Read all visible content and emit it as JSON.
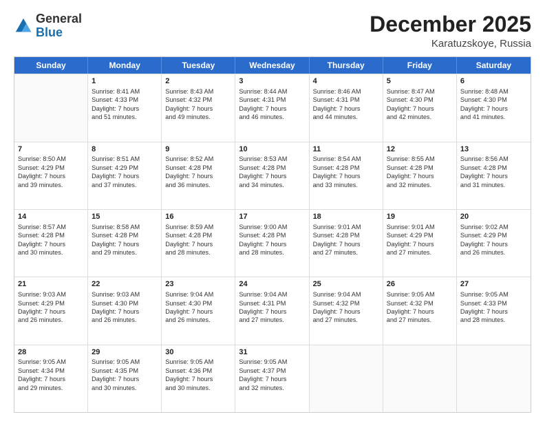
{
  "logo": {
    "general": "General",
    "blue": "Blue"
  },
  "title": "December 2025",
  "location": "Karatuzskoye, Russia",
  "days_of_week": [
    "Sunday",
    "Monday",
    "Tuesday",
    "Wednesday",
    "Thursday",
    "Friday",
    "Saturday"
  ],
  "weeks": [
    [
      {
        "day": "",
        "info": [],
        "empty": true
      },
      {
        "day": "1",
        "info": [
          "Sunrise: 8:41 AM",
          "Sunset: 4:33 PM",
          "Daylight: 7 hours",
          "and 51 minutes."
        ]
      },
      {
        "day": "2",
        "info": [
          "Sunrise: 8:43 AM",
          "Sunset: 4:32 PM",
          "Daylight: 7 hours",
          "and 49 minutes."
        ]
      },
      {
        "day": "3",
        "info": [
          "Sunrise: 8:44 AM",
          "Sunset: 4:31 PM",
          "Daylight: 7 hours",
          "and 46 minutes."
        ]
      },
      {
        "day": "4",
        "info": [
          "Sunrise: 8:46 AM",
          "Sunset: 4:31 PM",
          "Daylight: 7 hours",
          "and 44 minutes."
        ]
      },
      {
        "day": "5",
        "info": [
          "Sunrise: 8:47 AM",
          "Sunset: 4:30 PM",
          "Daylight: 7 hours",
          "and 42 minutes."
        ]
      },
      {
        "day": "6",
        "info": [
          "Sunrise: 8:48 AM",
          "Sunset: 4:30 PM",
          "Daylight: 7 hours",
          "and 41 minutes."
        ]
      }
    ],
    [
      {
        "day": "7",
        "info": [
          "Sunrise: 8:50 AM",
          "Sunset: 4:29 PM",
          "Daylight: 7 hours",
          "and 39 minutes."
        ]
      },
      {
        "day": "8",
        "info": [
          "Sunrise: 8:51 AM",
          "Sunset: 4:29 PM",
          "Daylight: 7 hours",
          "and 37 minutes."
        ]
      },
      {
        "day": "9",
        "info": [
          "Sunrise: 8:52 AM",
          "Sunset: 4:28 PM",
          "Daylight: 7 hours",
          "and 36 minutes."
        ]
      },
      {
        "day": "10",
        "info": [
          "Sunrise: 8:53 AM",
          "Sunset: 4:28 PM",
          "Daylight: 7 hours",
          "and 34 minutes."
        ]
      },
      {
        "day": "11",
        "info": [
          "Sunrise: 8:54 AM",
          "Sunset: 4:28 PM",
          "Daylight: 7 hours",
          "and 33 minutes."
        ]
      },
      {
        "day": "12",
        "info": [
          "Sunrise: 8:55 AM",
          "Sunset: 4:28 PM",
          "Daylight: 7 hours",
          "and 32 minutes."
        ]
      },
      {
        "day": "13",
        "info": [
          "Sunrise: 8:56 AM",
          "Sunset: 4:28 PM",
          "Daylight: 7 hours",
          "and 31 minutes."
        ]
      }
    ],
    [
      {
        "day": "14",
        "info": [
          "Sunrise: 8:57 AM",
          "Sunset: 4:28 PM",
          "Daylight: 7 hours",
          "and 30 minutes."
        ]
      },
      {
        "day": "15",
        "info": [
          "Sunrise: 8:58 AM",
          "Sunset: 4:28 PM",
          "Daylight: 7 hours",
          "and 29 minutes."
        ]
      },
      {
        "day": "16",
        "info": [
          "Sunrise: 8:59 AM",
          "Sunset: 4:28 PM",
          "Daylight: 7 hours",
          "and 28 minutes."
        ]
      },
      {
        "day": "17",
        "info": [
          "Sunrise: 9:00 AM",
          "Sunset: 4:28 PM",
          "Daylight: 7 hours",
          "and 28 minutes."
        ]
      },
      {
        "day": "18",
        "info": [
          "Sunrise: 9:01 AM",
          "Sunset: 4:28 PM",
          "Daylight: 7 hours",
          "and 27 minutes."
        ]
      },
      {
        "day": "19",
        "info": [
          "Sunrise: 9:01 AM",
          "Sunset: 4:29 PM",
          "Daylight: 7 hours",
          "and 27 minutes."
        ]
      },
      {
        "day": "20",
        "info": [
          "Sunrise: 9:02 AM",
          "Sunset: 4:29 PM",
          "Daylight: 7 hours",
          "and 26 minutes."
        ]
      }
    ],
    [
      {
        "day": "21",
        "info": [
          "Sunrise: 9:03 AM",
          "Sunset: 4:29 PM",
          "Daylight: 7 hours",
          "and 26 minutes."
        ]
      },
      {
        "day": "22",
        "info": [
          "Sunrise: 9:03 AM",
          "Sunset: 4:30 PM",
          "Daylight: 7 hours",
          "and 26 minutes."
        ]
      },
      {
        "day": "23",
        "info": [
          "Sunrise: 9:04 AM",
          "Sunset: 4:30 PM",
          "Daylight: 7 hours",
          "and 26 minutes."
        ]
      },
      {
        "day": "24",
        "info": [
          "Sunrise: 9:04 AM",
          "Sunset: 4:31 PM",
          "Daylight: 7 hours",
          "and 27 minutes."
        ]
      },
      {
        "day": "25",
        "info": [
          "Sunrise: 9:04 AM",
          "Sunset: 4:32 PM",
          "Daylight: 7 hours",
          "and 27 minutes."
        ]
      },
      {
        "day": "26",
        "info": [
          "Sunrise: 9:05 AM",
          "Sunset: 4:32 PM",
          "Daylight: 7 hours",
          "and 27 minutes."
        ]
      },
      {
        "day": "27",
        "info": [
          "Sunrise: 9:05 AM",
          "Sunset: 4:33 PM",
          "Daylight: 7 hours",
          "and 28 minutes."
        ]
      }
    ],
    [
      {
        "day": "28",
        "info": [
          "Sunrise: 9:05 AM",
          "Sunset: 4:34 PM",
          "Daylight: 7 hours",
          "and 29 minutes."
        ]
      },
      {
        "day": "29",
        "info": [
          "Sunrise: 9:05 AM",
          "Sunset: 4:35 PM",
          "Daylight: 7 hours",
          "and 30 minutes."
        ]
      },
      {
        "day": "30",
        "info": [
          "Sunrise: 9:05 AM",
          "Sunset: 4:36 PM",
          "Daylight: 7 hours",
          "and 30 minutes."
        ]
      },
      {
        "day": "31",
        "info": [
          "Sunrise: 9:05 AM",
          "Sunset: 4:37 PM",
          "Daylight: 7 hours",
          "and 32 minutes."
        ]
      },
      {
        "day": "",
        "info": [],
        "empty": true
      },
      {
        "day": "",
        "info": [],
        "empty": true
      },
      {
        "day": "",
        "info": [],
        "empty": true
      }
    ]
  ]
}
